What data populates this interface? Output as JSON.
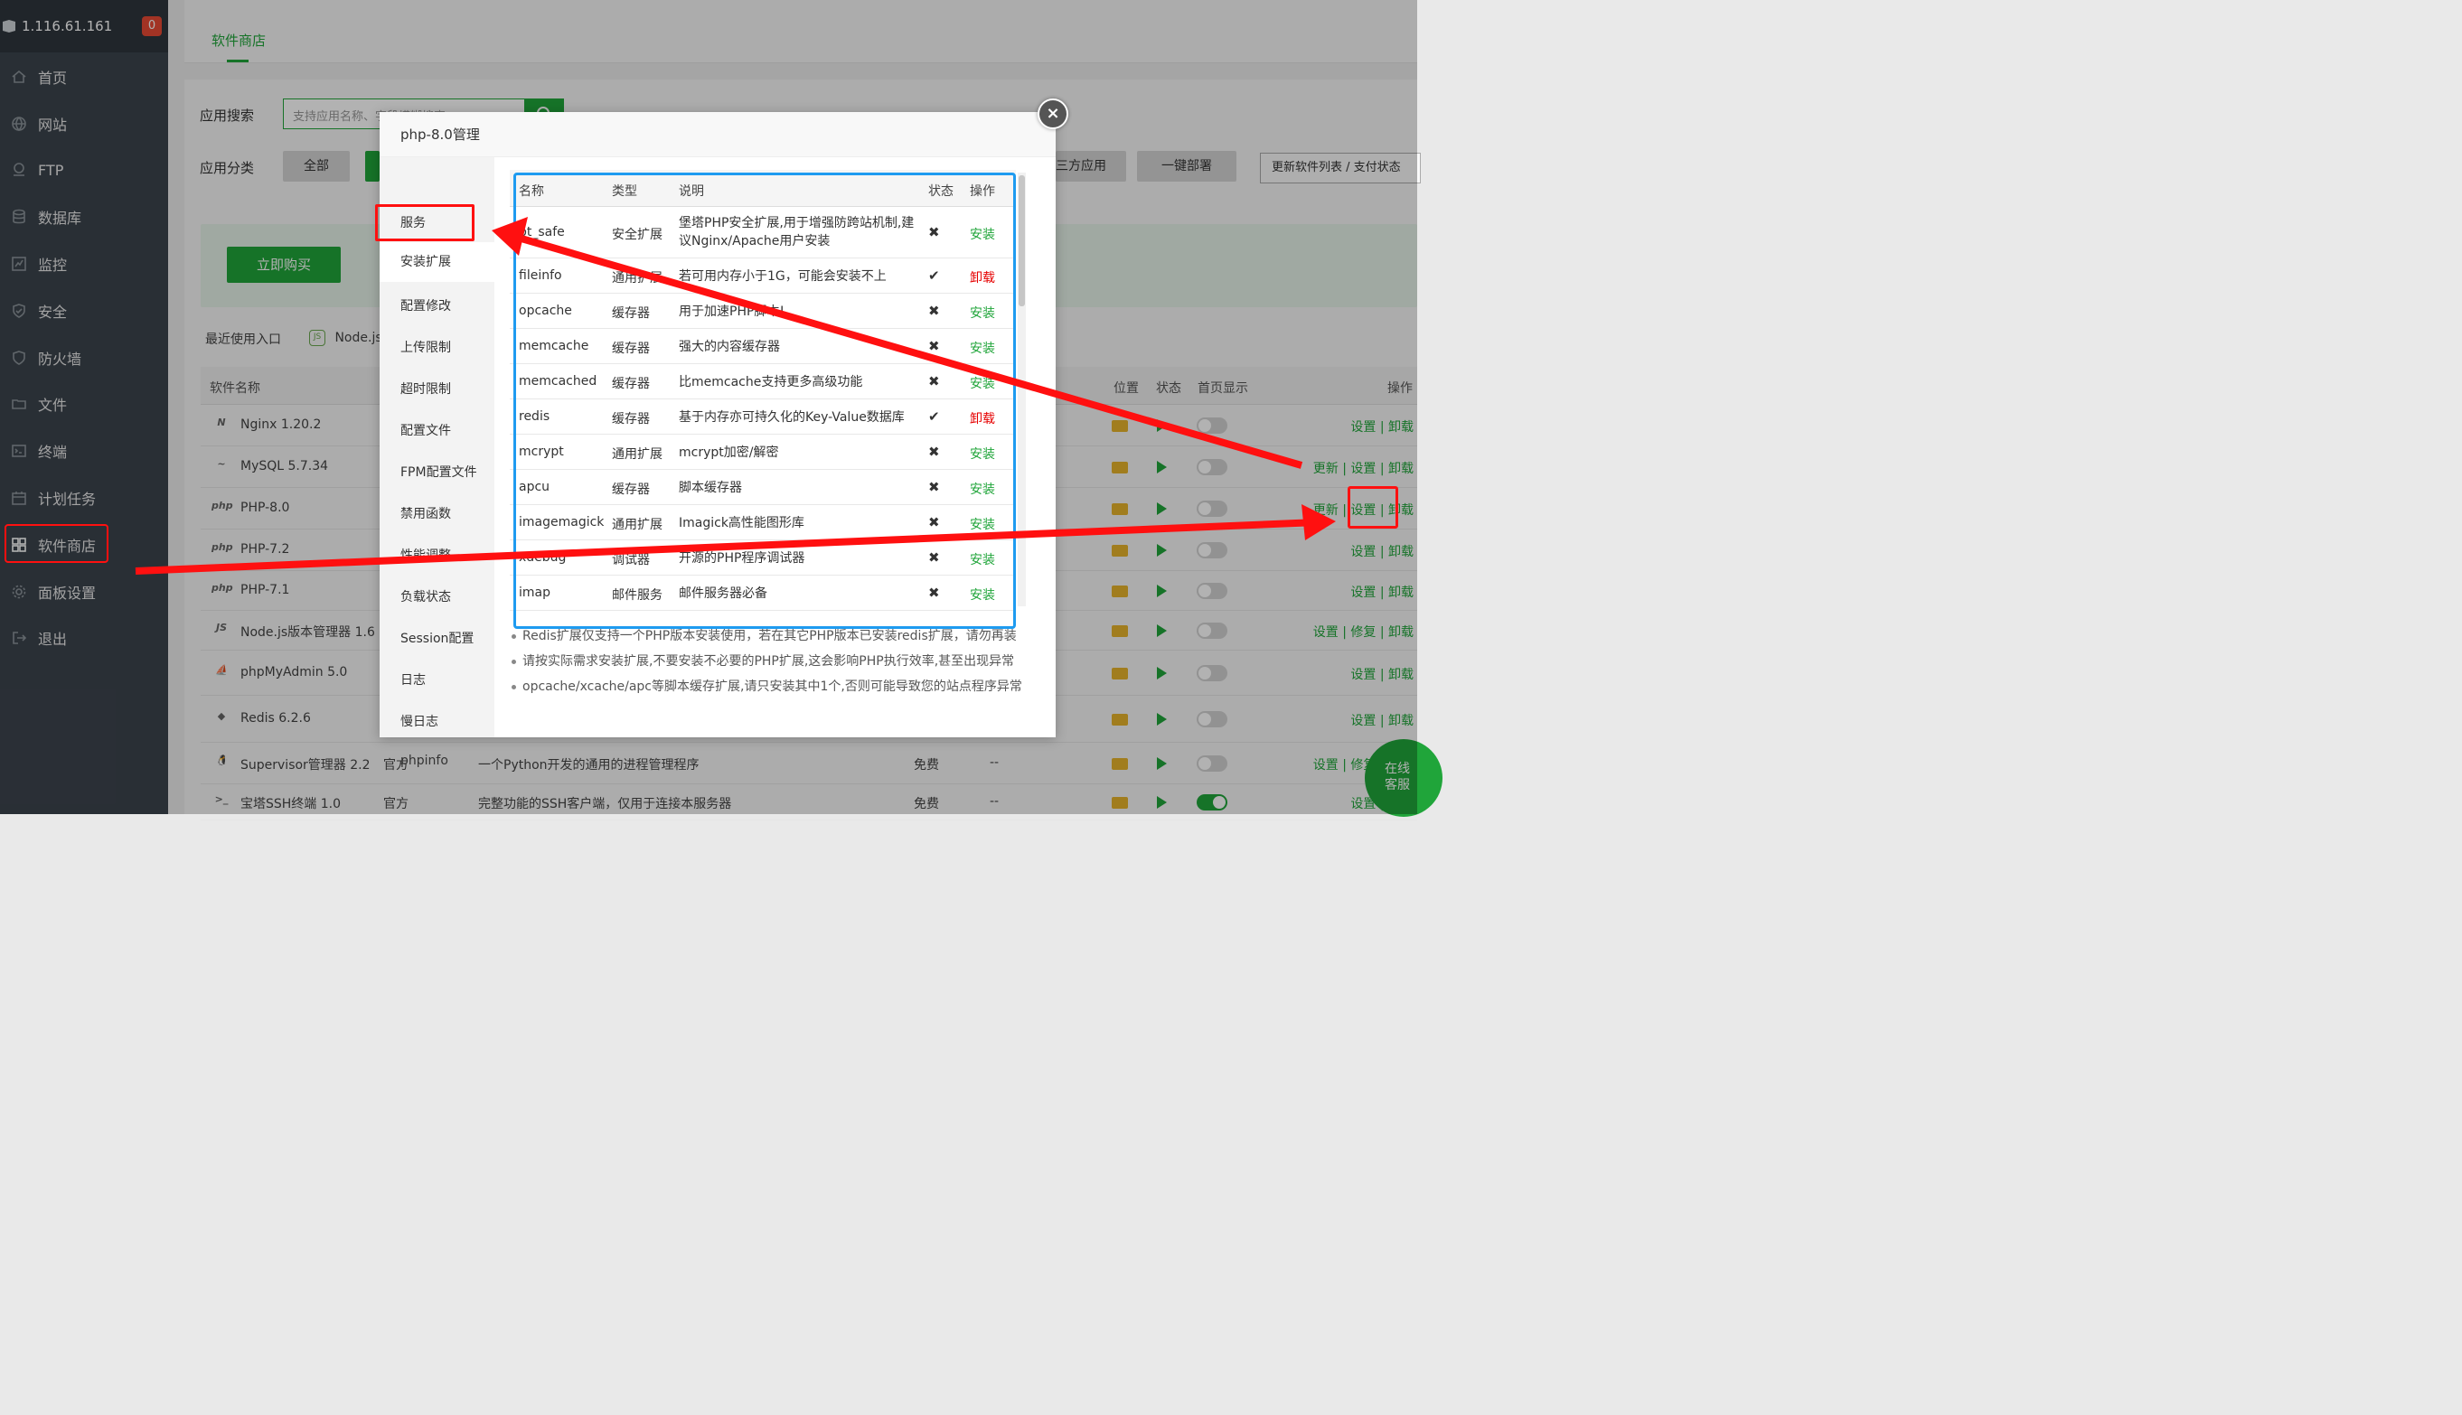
{
  "server": {
    "ip": "1.116.61.161",
    "badge": "0"
  },
  "sidebar": {
    "items": [
      {
        "label": "首页",
        "icon": "home-icon"
      },
      {
        "label": "网站",
        "icon": "globe-icon"
      },
      {
        "label": "FTP",
        "icon": "ftp-icon"
      },
      {
        "label": "数据库",
        "icon": "database-icon"
      },
      {
        "label": "监控",
        "icon": "monitor-icon"
      },
      {
        "label": "安全",
        "icon": "shield-icon"
      },
      {
        "label": "防火墙",
        "icon": "firewall-icon"
      },
      {
        "label": "文件",
        "icon": "folder-icon"
      },
      {
        "label": "终端",
        "icon": "terminal-icon"
      },
      {
        "label": "计划任务",
        "icon": "calendar-icon"
      },
      {
        "label": "软件商店",
        "icon": "apps-grid-icon",
        "active": true
      },
      {
        "label": "面板设置",
        "icon": "gear-icon"
      },
      {
        "label": "退出",
        "icon": "logout-icon"
      }
    ]
  },
  "store": {
    "tab": "软件商店",
    "search_label": "应用搜索",
    "search_placeholder": "支持应用名称、字段模糊搜索",
    "category_label": "应用分类",
    "categories": [
      "全部",
      "三方应用",
      "一键部署"
    ],
    "update_button": "更新软件列表 / 支付状态",
    "buy_button": "立即购买",
    "recent_label": "最近使用入口",
    "recent_item": "Node.js",
    "columns": {
      "name": "软件名称",
      "location": "位置",
      "status": "状态",
      "homepage": "首页显示",
      "ops": "操作"
    },
    "rows": [
      {
        "name": "Nginx 1.20.2",
        "icon": "N",
        "ops": "设置 | 卸载"
      },
      {
        "name": "MySQL 5.7.34",
        "icon": "~",
        "ops": "更新 | 设置 | 卸载"
      },
      {
        "name": "PHP-8.0",
        "icon": "php",
        "ops": "更新 | 设置 | 卸载"
      },
      {
        "name": "PHP-7.2",
        "icon": "php",
        "ops": "设置 | 卸载"
      },
      {
        "name": "PHP-7.1",
        "icon": "php",
        "ops": "设置 | 卸载"
      },
      {
        "name": "Node.js版本管理器 1.6",
        "icon": "JS",
        "ops": "设置 | 修复 | 卸载"
      },
      {
        "name": "phpMyAdmin 5.0",
        "icon": "⛵",
        "ops": "设置 | 卸载"
      },
      {
        "name": "Redis 6.2.6",
        "icon": "◆",
        "ops": "设置 | 卸载"
      },
      {
        "name": "Supervisor管理器 2.2",
        "icon": "🐧",
        "type": "官方",
        "desc": "一个Python开发的通用的进程管理程序",
        "price": "免费",
        "expire": "--",
        "ops": "设置 | 修复 | 卸载"
      },
      {
        "name": "宝塔SSH终端 1.0",
        "icon": ">_",
        "type": "官方",
        "desc": "完整功能的SSH客户端，仅用于连接本服务器",
        "price": "免费",
        "expire": "--",
        "ops": "设置 | 修复"
      }
    ],
    "customer_service": [
      "在线",
      "客服"
    ]
  },
  "modal": {
    "title": "php-8.0管理",
    "close": "×",
    "nav": [
      "服务",
      "安装扩展",
      "配置修改",
      "上传限制",
      "超时限制",
      "配置文件",
      "FPM配置文件",
      "禁用函数",
      "性能调整",
      "负载状态",
      "Session配置",
      "日志",
      "慢日志",
      "phpinfo"
    ],
    "active_nav": "安装扩展",
    "columns": {
      "name": "名称",
      "type": "类型",
      "desc": "说明",
      "status": "状态",
      "op": "操作"
    },
    "extensions": [
      {
        "name": "bt_safe",
        "type": "安全扩展",
        "desc": "堡塔PHP安全扩展,用于增强防跨站机制,建议Nginx/Apache用户安装",
        "status": "✖",
        "op": "安装",
        "installed": false
      },
      {
        "name": "fileinfo",
        "type": "通用扩展",
        "desc": "若可用内存小于1G，可能会安装不上",
        "status": "✔",
        "op": "卸载",
        "installed": true
      },
      {
        "name": "opcache",
        "type": "缓存器",
        "desc": "用于加速PHP脚本!",
        "status": "✖",
        "op": "安装",
        "installed": false
      },
      {
        "name": "memcache",
        "type": "缓存器",
        "desc": "强大的内容缓存器",
        "status": "✖",
        "op": "安装",
        "installed": false
      },
      {
        "name": "memcached",
        "type": "缓存器",
        "desc": "比memcache支持更多高级功能",
        "status": "✖",
        "op": "安装",
        "installed": false
      },
      {
        "name": "redis",
        "type": "缓存器",
        "desc": "基于内存亦可持久化的Key-Value数据库",
        "status": "✔",
        "op": "卸载",
        "installed": true
      },
      {
        "name": "mcrypt",
        "type": "通用扩展",
        "desc": "mcrypt加密/解密",
        "status": "✖",
        "op": "安装",
        "installed": false
      },
      {
        "name": "apcu",
        "type": "缓存器",
        "desc": "脚本缓存器",
        "status": "✖",
        "op": "安装",
        "installed": false
      },
      {
        "name": "imagemagick",
        "type": "通用扩展",
        "desc": "Imagick高性能图形库",
        "status": "✖",
        "op": "安装",
        "installed": false
      },
      {
        "name": "xdebug",
        "type": "调试器",
        "desc": "开源的PHP程序调试器",
        "status": "✖",
        "op": "安装",
        "installed": false
      },
      {
        "name": "imap",
        "type": "邮件服务",
        "desc": "邮件服务器必备",
        "status": "✖",
        "op": "安装",
        "installed": false
      }
    ],
    "notes": [
      "Redis扩展仅支持一个PHP版本安装使用，若在其它PHP版本已安装redis扩展，请勿再装",
      "请按实际需求安装扩展,不要安装不必要的PHP扩展,这会影响PHP执行效率,甚至出现异常",
      "opcache/xcache/apc等脚本缓存扩展,请只安装其中1个,否则可能导致您的站点程序异常"
    ]
  },
  "colors": {
    "accent": "#20a53a",
    "annotation": "#ff1010",
    "focus_frame": "#1e9bf0",
    "sidebar": "#3c444d"
  }
}
